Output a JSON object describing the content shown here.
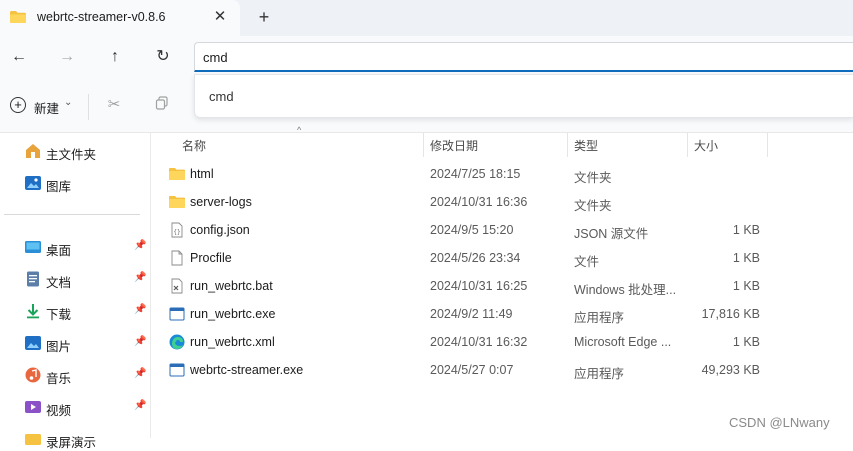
{
  "tab": {
    "title": "webrtc-streamer-v0.8.6",
    "close": "✕",
    "new_tab": "+"
  },
  "nav": {
    "back": "←",
    "forward": "→",
    "up": "↑",
    "refresh": "↻"
  },
  "address": {
    "value": "cmd"
  },
  "suggestions": [
    "cmd"
  ],
  "toolbar": {
    "new_label": "新建",
    "new_chevron": "⌄"
  },
  "sidebar": {
    "top_items": [
      {
        "label": "主文件夹",
        "icon": "home-icon"
      },
      {
        "label": "图库",
        "icon": "gallery-icon"
      }
    ],
    "pinned_items": [
      {
        "label": "桌面",
        "icon": "desktop-icon",
        "pin": "📌"
      },
      {
        "label": "文档",
        "icon": "documents-icon",
        "pin": "📌"
      },
      {
        "label": "下载",
        "icon": "downloads-icon",
        "pin": "📌"
      },
      {
        "label": "图片",
        "icon": "pictures-icon",
        "pin": "📌"
      },
      {
        "label": "音乐",
        "icon": "music-icon",
        "pin": "📌"
      },
      {
        "label": "视频",
        "icon": "videos-icon",
        "pin": "📌"
      },
      {
        "label": "录屏演示",
        "icon": "folder-icon"
      }
    ]
  },
  "columns": {
    "name": "名称",
    "modified": "修改日期",
    "type": "类型",
    "size": "大小",
    "sort_indicator": "^"
  },
  "files": [
    {
      "name": "html",
      "modified": "2024/7/25 18:15",
      "type": "文件夹",
      "size": "",
      "icon": "folder-icon"
    },
    {
      "name": "server-logs",
      "modified": "2024/10/31 16:36",
      "type": "文件夹",
      "size": "",
      "icon": "folder-icon"
    },
    {
      "name": "config.json",
      "modified": "2024/9/5 15:20",
      "type": "JSON 源文件",
      "size": "1 KB",
      "icon": "json-file-icon"
    },
    {
      "name": "Procfile",
      "modified": "2024/5/26 23:34",
      "type": "文件",
      "size": "1 KB",
      "icon": "file-icon"
    },
    {
      "name": "run_webrtc.bat",
      "modified": "2024/10/31 16:25",
      "type": "Windows 批处理...",
      "size": "1 KB",
      "icon": "batch-file-icon"
    },
    {
      "name": "run_webrtc.exe",
      "modified": "2024/9/2 11:49",
      "type": "应用程序",
      "size": "17,816 KB",
      "icon": "exe-file-icon"
    },
    {
      "name": "run_webrtc.xml",
      "modified": "2024/10/31 16:32",
      "type": "Microsoft Edge ...",
      "size": "1 KB",
      "icon": "edge-icon"
    },
    {
      "name": "webrtc-streamer.exe",
      "modified": "2024/5/27 0:07",
      "type": "应用程序",
      "size": "49,293 KB",
      "icon": "exe-file-icon"
    }
  ],
  "watermark": "CSDN @LNwany",
  "colors": {
    "accent": "#0f6cbd",
    "folder": "#f5c242",
    "tabbar": "#eef1f6"
  }
}
